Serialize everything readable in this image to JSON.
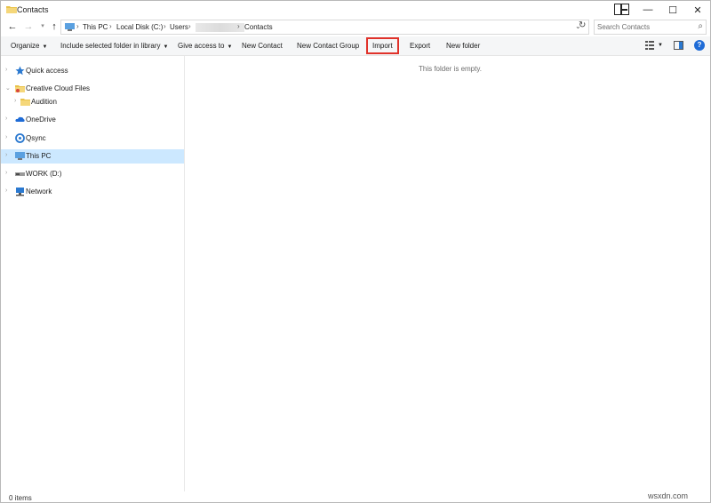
{
  "window": {
    "title": "Contacts"
  },
  "titlebar": {
    "minimize": "—",
    "maximize": "☐",
    "close": "✕"
  },
  "address": {
    "crumbs": [
      "This PC",
      "Local Disk (C:)",
      "Users",
      "Contacts"
    ]
  },
  "search": {
    "placeholder": "Search Contacts"
  },
  "toolbar": {
    "organize": "Organize",
    "include_library": "Include selected folder in library",
    "give_access": "Give access to",
    "new_contact": "New Contact",
    "new_contact_group": "New Contact Group",
    "import": "Import",
    "export": "Export",
    "new_folder": "New folder",
    "help": "?"
  },
  "nav": {
    "items": [
      {
        "label": "Quick access",
        "icon": "star-icon"
      },
      {
        "label": "Creative Cloud Files",
        "icon": "cloud-folder-icon"
      },
      {
        "label": "Audition",
        "icon": "folder-icon"
      },
      {
        "label": "OneDrive",
        "icon": "onedrive-icon"
      },
      {
        "label": "Qsync",
        "icon": "qsync-icon"
      },
      {
        "label": "This PC",
        "icon": "computer-icon",
        "selected": true
      },
      {
        "label": "WORK (D:)",
        "icon": "drive-icon"
      },
      {
        "label": "Network",
        "icon": "network-icon"
      }
    ]
  },
  "content": {
    "empty_message": "This folder is empty."
  },
  "status": {
    "items_count": "0 items"
  },
  "watermark": "wsxdn.com",
  "colors": {
    "accent": "#1e6bd6",
    "selection": "#cce8ff",
    "highlight_box": "#e0322a"
  }
}
